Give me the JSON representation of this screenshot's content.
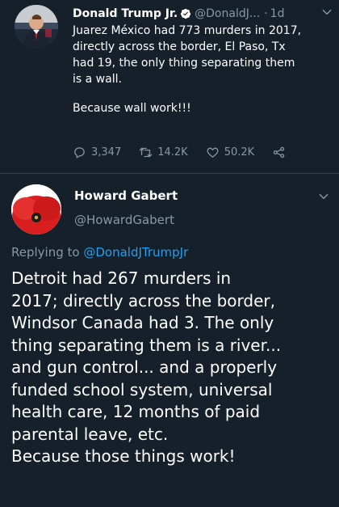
{
  "tweet": {
    "author_name": "Donald Trump Jr.",
    "handle": "@DonaldJ...",
    "time": "1d",
    "lines": [
      "Juarez México had 773 murders in 2017,",
      "directly across the border, El Paso, Tx",
      "had 19, the only thing separating them",
      "is a wall."
    ],
    "line_last": "Because wall work!!!",
    "replies": "3,347",
    "retweets": "14.2K",
    "likes": "50.2K",
    "icons": [
      "verified-badge",
      "chevron-down",
      "reply",
      "retweet",
      "heart",
      "share"
    ]
  },
  "reply": {
    "author_name": "Howard Gabert",
    "handle": "@HowardGabert",
    "replying_prefix": "Replying to",
    "replying_mention": "@DonaldJTrumpJr",
    "lines": [
      "Detroit had 267 murders in",
      "2017; directly across the border,",
      "Windsor Canada had 3.  The only",
      "thing separating them is a river...",
      "and gun control... and a properly",
      "funded school system, universal",
      "health care, 12 months of paid",
      "parental leave, etc.",
      "Because those things work!"
    ]
  },
  "colors": {
    "background": "#15202b",
    "secondary_text": "#8899a6",
    "link": "#1da1f2",
    "verified": "#1da1f2"
  }
}
